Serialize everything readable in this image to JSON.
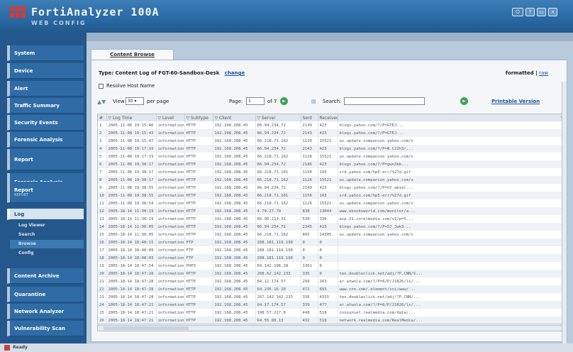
{
  "app": {
    "title": "FortiAnalyzer 100A",
    "subtitle": "WEB CONFIG"
  },
  "header_icons": [
    "logout-icon",
    "help-icon",
    "console-icon",
    "close-icon"
  ],
  "header_icon_glyphs": [
    "⏻",
    "?",
    "▭",
    "×"
  ],
  "sidebar": {
    "items": [
      {
        "label": "System"
      },
      {
        "label": "Device"
      },
      {
        "label": "Alert"
      },
      {
        "label": "Traffic Summary"
      },
      {
        "label": "Security Events"
      },
      {
        "label": "Forensic Analysis"
      },
      {
        "label": "Report"
      },
      {
        "label": "Forensic Analysis"
      },
      {
        "label": "Report",
        "sub": "REPORT"
      },
      {
        "label": "Log"
      },
      {
        "label": "Content Archive"
      },
      {
        "label": "Quarantine"
      },
      {
        "label": "Network Analyzer"
      },
      {
        "label": "Vulnerability Scan"
      }
    ],
    "log_sub": [
      "Log Viewer",
      "Search",
      "Browse",
      "Config"
    ]
  },
  "tab": {
    "label": "Content Browse"
  },
  "content": {
    "type_text": "Type: Content Log of FGT-60-Sandbox-Desk",
    "change_link": "change",
    "formatted": "formatted |",
    "raw": "raw",
    "resolve_label": "Resolve Host Name",
    "view_label": "View",
    "per_page_value": "30",
    "per_page_label": "per page",
    "page_label": "Page:",
    "page_value": "1",
    "of_label": "of 7",
    "search_label": "Search:",
    "printable": "Printable Version"
  },
  "table": {
    "columns": [
      "#",
      "Log Time",
      "Level",
      "Subtype",
      "Client",
      "Server",
      "Sent",
      "Received",
      ""
    ],
    "rows": [
      [
        "1",
        "2005-11-08 19:15:46",
        "information",
        "HTTP",
        "192.168.208.45",
        "66.94.234.72",
        "2149",
        "423",
        "blogs.yahoo.com/?/P=GTEJ..."
      ],
      [
        "2",
        "2005-11-08 19:15:43",
        "information",
        "HTTP",
        "192.168.208.45",
        "66.94.234.72",
        "2143",
        "423",
        "blogs.yahoo.com/?/P=GTEJ..."
      ],
      [
        "3",
        "2005-11-08 19:15:47",
        "information",
        "HTTP",
        "192.168.208.45",
        "66.218.71.162",
        "1126",
        "15521",
        "us.update.companion.yahoo.com/s"
      ],
      [
        "4",
        "2005-11-08 19:17:19",
        "information",
        "HTTP",
        "192.168.208.45",
        "66.94.234.72",
        "2143",
        "423",
        "blogs.yahoo.com/?/P=N.C22h3/..."
      ],
      [
        "5",
        "2005-11-08 19:17:19",
        "information",
        "HTTP",
        "192.168.208.45",
        "66.218.71.162",
        "1126",
        "15521",
        "us.update.companion.yahoo.com/s"
      ],
      [
        "6",
        "2005-11-08 19:38:17",
        "information",
        "HTTP",
        "192.168.208.45",
        "66.94.234.72",
        "2186",
        "423",
        "blogs.yahoo.com/?/P=gwn3kb..."
      ],
      [
        "7",
        "2005-11-08 19:38:17",
        "information",
        "HTTP",
        "192.168.208.45",
        "66.218.71.101",
        "1156",
        "193",
        "srd.yahoo.com/hp5-err/%27d.gif"
      ],
      [
        "8",
        "2005-11-08 19:38:17",
        "information",
        "HTTP",
        "192.168.208.45",
        "66.218.71.162",
        "1126",
        "15521",
        "us.update.companion.yahoo.com/s"
      ],
      [
        "9",
        "2005-11-08 19:38:55",
        "information",
        "HTTP",
        "192.168.208.45",
        "66.94.234.72",
        "2149",
        "423",
        "blogs.yahoo.com/?/P=nY_abiel..."
      ],
      [
        "10",
        "2005-11-08 19:38:55",
        "information",
        "HTTP",
        "192.168.208.45",
        "66.218.71.101",
        "1156",
        "193",
        "srd.yahoo.com/hp5-err/%27d.gif"
      ],
      [
        "11",
        "2005-11-08 19:38:54",
        "information",
        "HTTP",
        "192.168.208.45",
        "66.218.71.162",
        "1126",
        "15521",
        "us.update.companion.yahoo.com/s"
      ],
      [
        "12",
        "2005-18-14 11:30:19",
        "information",
        "HTTP",
        "192.168.208.45",
        "4.79.27.79",
        "830",
        "13044",
        "www.ebooksworld.com/monitor/a..."
      ],
      [
        "13",
        "2005-18-14 11:30:19",
        "information",
        "HTTP",
        "192.168.208.45",
        "66.90.213.31",
        "530",
        "336",
        "asp.21.corelmedia.com/v1/p=5..."
      ],
      [
        "14",
        "2005-18-14 11:30:05",
        "information",
        "HTTP",
        "192.168.208.45",
        "66.94.234.72",
        "2345",
        "423",
        "blogs.yahoo.com/?/P=57_Jwk3..."
      ],
      [
        "15",
        "2005-18-14 11:30:05",
        "information",
        "HTTP",
        "192.168.208.45",
        "66.218.71.162",
        "895",
        "14305",
        "us.update.companion.yahoo.com/s"
      ],
      [
        "16",
        "2005-18-14 18:48:15",
        "information",
        "FTP",
        "192.168.208.45",
        "208.181.119.190",
        "0",
        "0",
        ""
      ],
      [
        "17",
        "2005-18-14 18:48:09",
        "information",
        "FTP",
        "192.168.208.45",
        "208.181.119.190",
        "0",
        "0",
        ""
      ],
      [
        "18",
        "2005-18-14 18:48:03",
        "information",
        "FTP",
        "192.168.208.45",
        "208.181.119.190",
        "0",
        "0",
        ""
      ],
      [
        "19",
        "2005-18-14 18:47:54",
        "information",
        "POP3",
        "192.168.208.45",
        "69.142.196.28",
        "1361",
        "0",
        ""
      ],
      [
        "20",
        "2005-18-14 18:47:28",
        "information",
        "HTTP",
        "192.168.208.45",
        "208.62.142.233",
        "335",
        "0",
        "ten.doubleclick.net/adj/?P.CNN/S..."
      ],
      [
        "21",
        "2005-18-14 18:47:28",
        "information",
        "HTTP",
        "192.168.208.45",
        "64.12.174.57",
        "299",
        "263",
        "ar.atwola.com/?/P=6/P/J1826/ls/..."
      ],
      [
        "22",
        "2005-18-14 18:47:28",
        "information",
        "HTTP",
        "192.168.208.45",
        "64.236.16.20",
        "472",
        "693",
        "www.cnn.com/.element/ssi/www/..."
      ],
      [
        "23",
        "2005-18-14 18:47:28",
        "information",
        "HTTP",
        "192.168.208.45",
        "207.142.142.233",
        "336",
        "4315",
        "ten.doubleclick.net/adj/?P.CNN/..."
      ],
      [
        "24",
        "2005-18-14 18:47:21",
        "information",
        "HTTP",
        "192.168.208.45",
        "64.17.174.57",
        "339",
        "477",
        "ar.atwola.com/?/P=6/P/J1826/ls/..."
      ],
      [
        "25",
        "2005-18-14 18:47:21",
        "information",
        "HTTP",
        "192.168.208.45",
        "198.57.217.0",
        "448",
        "518",
        "cnnsunset.realmedia.com/data/..."
      ],
      [
        "26",
        "2005-18-14 18:47:21",
        "information",
        "HTTP",
        "192.168.208.45",
        "64.55.88.13",
        "432",
        "518",
        "network.realmedia.com/RealMedia/..."
      ]
    ]
  },
  "footer": {
    "text": "Ready"
  }
}
